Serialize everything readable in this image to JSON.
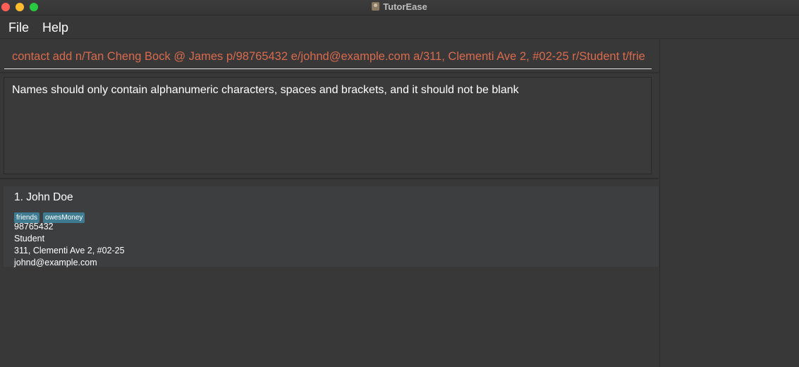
{
  "window": {
    "title": "TutorEase",
    "controls": {
      "close_color": "#ff5f57",
      "minimize_color": "#febc2e",
      "zoom_color": "#28c840"
    }
  },
  "menu": {
    "file": "File",
    "help": "Help"
  },
  "command": {
    "value": "contact add n/Tan Cheng Bock @ James p/98765432 e/johnd@example.com a/311, Clementi Ave 2, #02-25 r/Student t/frie"
  },
  "result": {
    "message": "Names should only contain alphanumeric characters, spaces and brackets, and it should not be blank"
  },
  "contacts": [
    {
      "index_name": "1. John Doe",
      "tags": [
        "friends",
        "owesMoney"
      ],
      "phone": "98765432",
      "role": "Student",
      "address": "311, Clementi Ave 2, #02-25",
      "email": "johnd@example.com"
    }
  ],
  "colors": {
    "command_text": "#d96a4e",
    "tag_background": "#3e7b91",
    "background": "#383838"
  }
}
